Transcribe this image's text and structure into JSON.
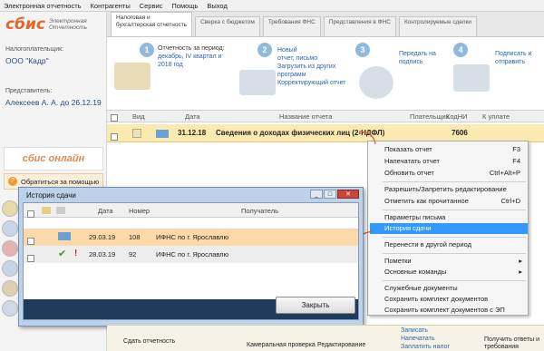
{
  "menu": [
    "Электронная отчетность",
    "Контрагенты",
    "Сервис",
    "Помощь",
    "Выход"
  ],
  "brand": {
    "logo": "сбис",
    "subtitle_1": "Электронная",
    "subtitle_2": "Отчетность"
  },
  "left": {
    "taxpayer_label": "Налогоплательщик:",
    "taxpayer": "ООО \"Кадр\"",
    "rep_label": "Представитель:",
    "rep": "Алексеев А. А. до 26.12.19",
    "online": "сбис онлайн",
    "help": "Обратиться за помощью"
  },
  "tabs": [
    {
      "l1": "Налоговая и",
      "l2": "бухгалтерская отчетность"
    },
    {
      "l1": "Сверка с бюджетом",
      "l2": ""
    },
    {
      "l1": "Требования ФНС",
      "l2": ""
    },
    {
      "l1": "Представления в ФНС",
      "l2": ""
    },
    {
      "l1": "Контролируемые сделки",
      "l2": ""
    }
  ],
  "steps": [
    {
      "n": "1",
      "l1": "Отчетность за период:",
      "l2": "декабрь, IV квартал и",
      "l3": "2018 год"
    },
    {
      "n": "2",
      "l1": "Новый",
      "l2": "отчет, письмо",
      "l3": "Загрузить из других",
      "l4": "программ",
      "l5": "Корректирующий отчет"
    },
    {
      "n": "3",
      "l1": "Передать на",
      "l2": "подпись"
    },
    {
      "n": "4",
      "l1": "Подписать и",
      "l2": "отправить"
    }
  ],
  "table": {
    "headers": [
      "Вид",
      "Дата",
      "Название отчета",
      "Плательщик",
      "КодНИ",
      "К уплате"
    ],
    "row": {
      "date": "31.12.18",
      "name": "Сведения о доходах физических лиц (2-НДФЛ)",
      "code": "7606"
    }
  },
  "context_menu": [
    {
      "label": "Показать отчет",
      "sc": "F3"
    },
    {
      "label": "Напечатать отчет",
      "sc": "F4"
    },
    {
      "label": "Обновить отчет",
      "sc": "Ctrl+Alt+P"
    },
    {
      "label": "Разрешить/Запретить редактирование",
      "sc": ""
    },
    {
      "label": "Отметить как прочитанное",
      "sc": "Ctrl+D"
    },
    {
      "label": "Параметры письма",
      "sc": ""
    },
    {
      "label": "История сдачи",
      "sc": ""
    },
    {
      "label": "Перенести в другой период",
      "sc": ""
    },
    {
      "label": "Пометки",
      "sc": ""
    },
    {
      "label": "Основные команды",
      "sc": ""
    },
    {
      "label": "Служебные документы",
      "sc": ""
    },
    {
      "label": "Сохранить комплект документов",
      "sc": ""
    },
    {
      "label": "Сохранить комплект документов с ЭП",
      "sc": ""
    }
  ],
  "dialog": {
    "title": "История сдачи",
    "headers": [
      "Дата",
      "Номер",
      "Получатель"
    ],
    "rows": [
      {
        "date": "29.03.19",
        "num": "108",
        "recipient": "ИФНС по г. Ярославлю"
      },
      {
        "date": "28.03.19",
        "num": "92",
        "recipient": "ИФНС по г. Ярославлю"
      }
    ],
    "close": "Закрыть"
  },
  "bottom": {
    "b1": "Сдать отчетность",
    "b2": "Камеральная проверка",
    "b3": "Редактирование",
    "b4": "Записать",
    "b5": "Напечатать",
    "b6": "Заплатить налог",
    "b7": "Получить ответы и требования"
  },
  "colors": {
    "accent": "#e3672b",
    "selected_row": "#fbeab0",
    "menu_highlight": "#3399ff"
  }
}
